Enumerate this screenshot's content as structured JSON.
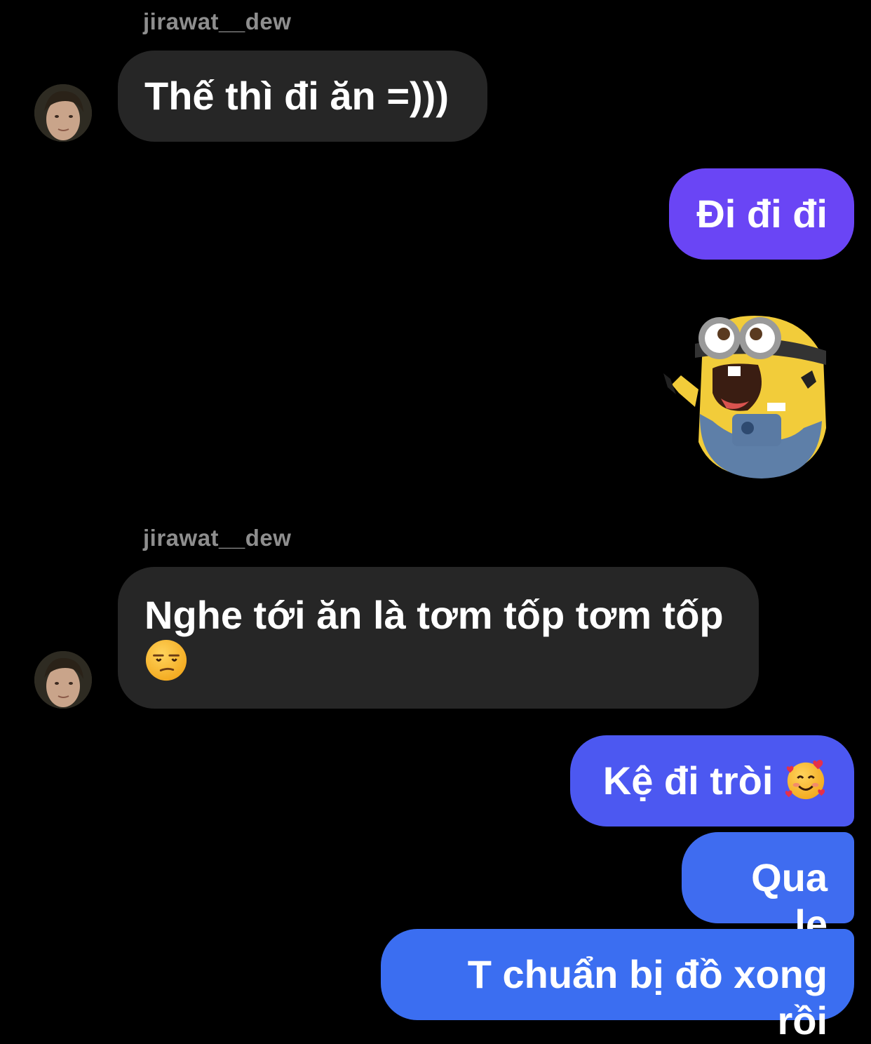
{
  "conversation": {
    "messages": [
      {
        "sender": "jirawat__dew",
        "text": "Thế thì đi ăn =)))",
        "direction": "incoming"
      },
      {
        "text": "Đi đi đi",
        "direction": "outgoing",
        "color": "#6a45f5"
      },
      {
        "type": "sticker",
        "description": "minion-sticker",
        "direction": "outgoing"
      },
      {
        "sender": "jirawat__dew",
        "text": "Nghe tới ăn là tơm tốp tơm tốp",
        "emoji": "unamused-face",
        "direction": "incoming"
      },
      {
        "text": "Kệ đi tròi",
        "emoji": "smiling-face-with-hearts",
        "direction": "outgoing",
        "color": "#4c58f1"
      },
      {
        "text": "Qua lẹ",
        "direction": "outgoing",
        "color": "#3f6cf0"
      },
      {
        "text": "T chuẩn bị đồ xong rồi",
        "direction": "outgoing",
        "color": "#3b6ef1"
      }
    ]
  },
  "colors": {
    "background": "#000000",
    "incoming_bubble": "#262626",
    "sender_name": "#8e8e8e"
  }
}
